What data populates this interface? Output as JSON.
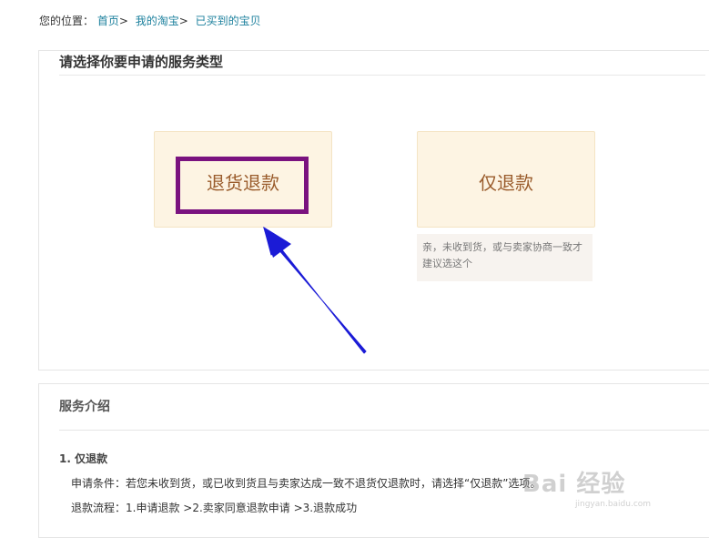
{
  "breadcrumb": {
    "prefix": "您的位置：",
    "items": [
      "首页",
      "我的淘宝",
      "已买到的宝贝"
    ],
    "separator": ">"
  },
  "service_type": {
    "title": "请选择你要申请的服务类型",
    "options": [
      {
        "label": "退货退款"
      },
      {
        "label": "仅退款",
        "tip": "亲，未收到货，或与卖家协商一致才建议选这个"
      }
    ]
  },
  "service_intro": {
    "title": "服务介绍",
    "section_title": "1. 仅退款",
    "condition": "申请条件：若您未收到货，或已收到货且与卖家达成一致不退货仅退款时，请选择“仅退款”选项。",
    "flow": "退款流程：1.申请退款 >2.卖家同意退款申请 >3.退款成功"
  },
  "watermark": {
    "main": "Bai 经验",
    "sub": "jingyan.baidu.com"
  },
  "colors": {
    "link": "#1a7f9c",
    "card_bg": "#fdf4e3",
    "card_text": "#9a5c2c",
    "highlight_border": "#7a127f",
    "arrow": "#1b1bd6"
  }
}
